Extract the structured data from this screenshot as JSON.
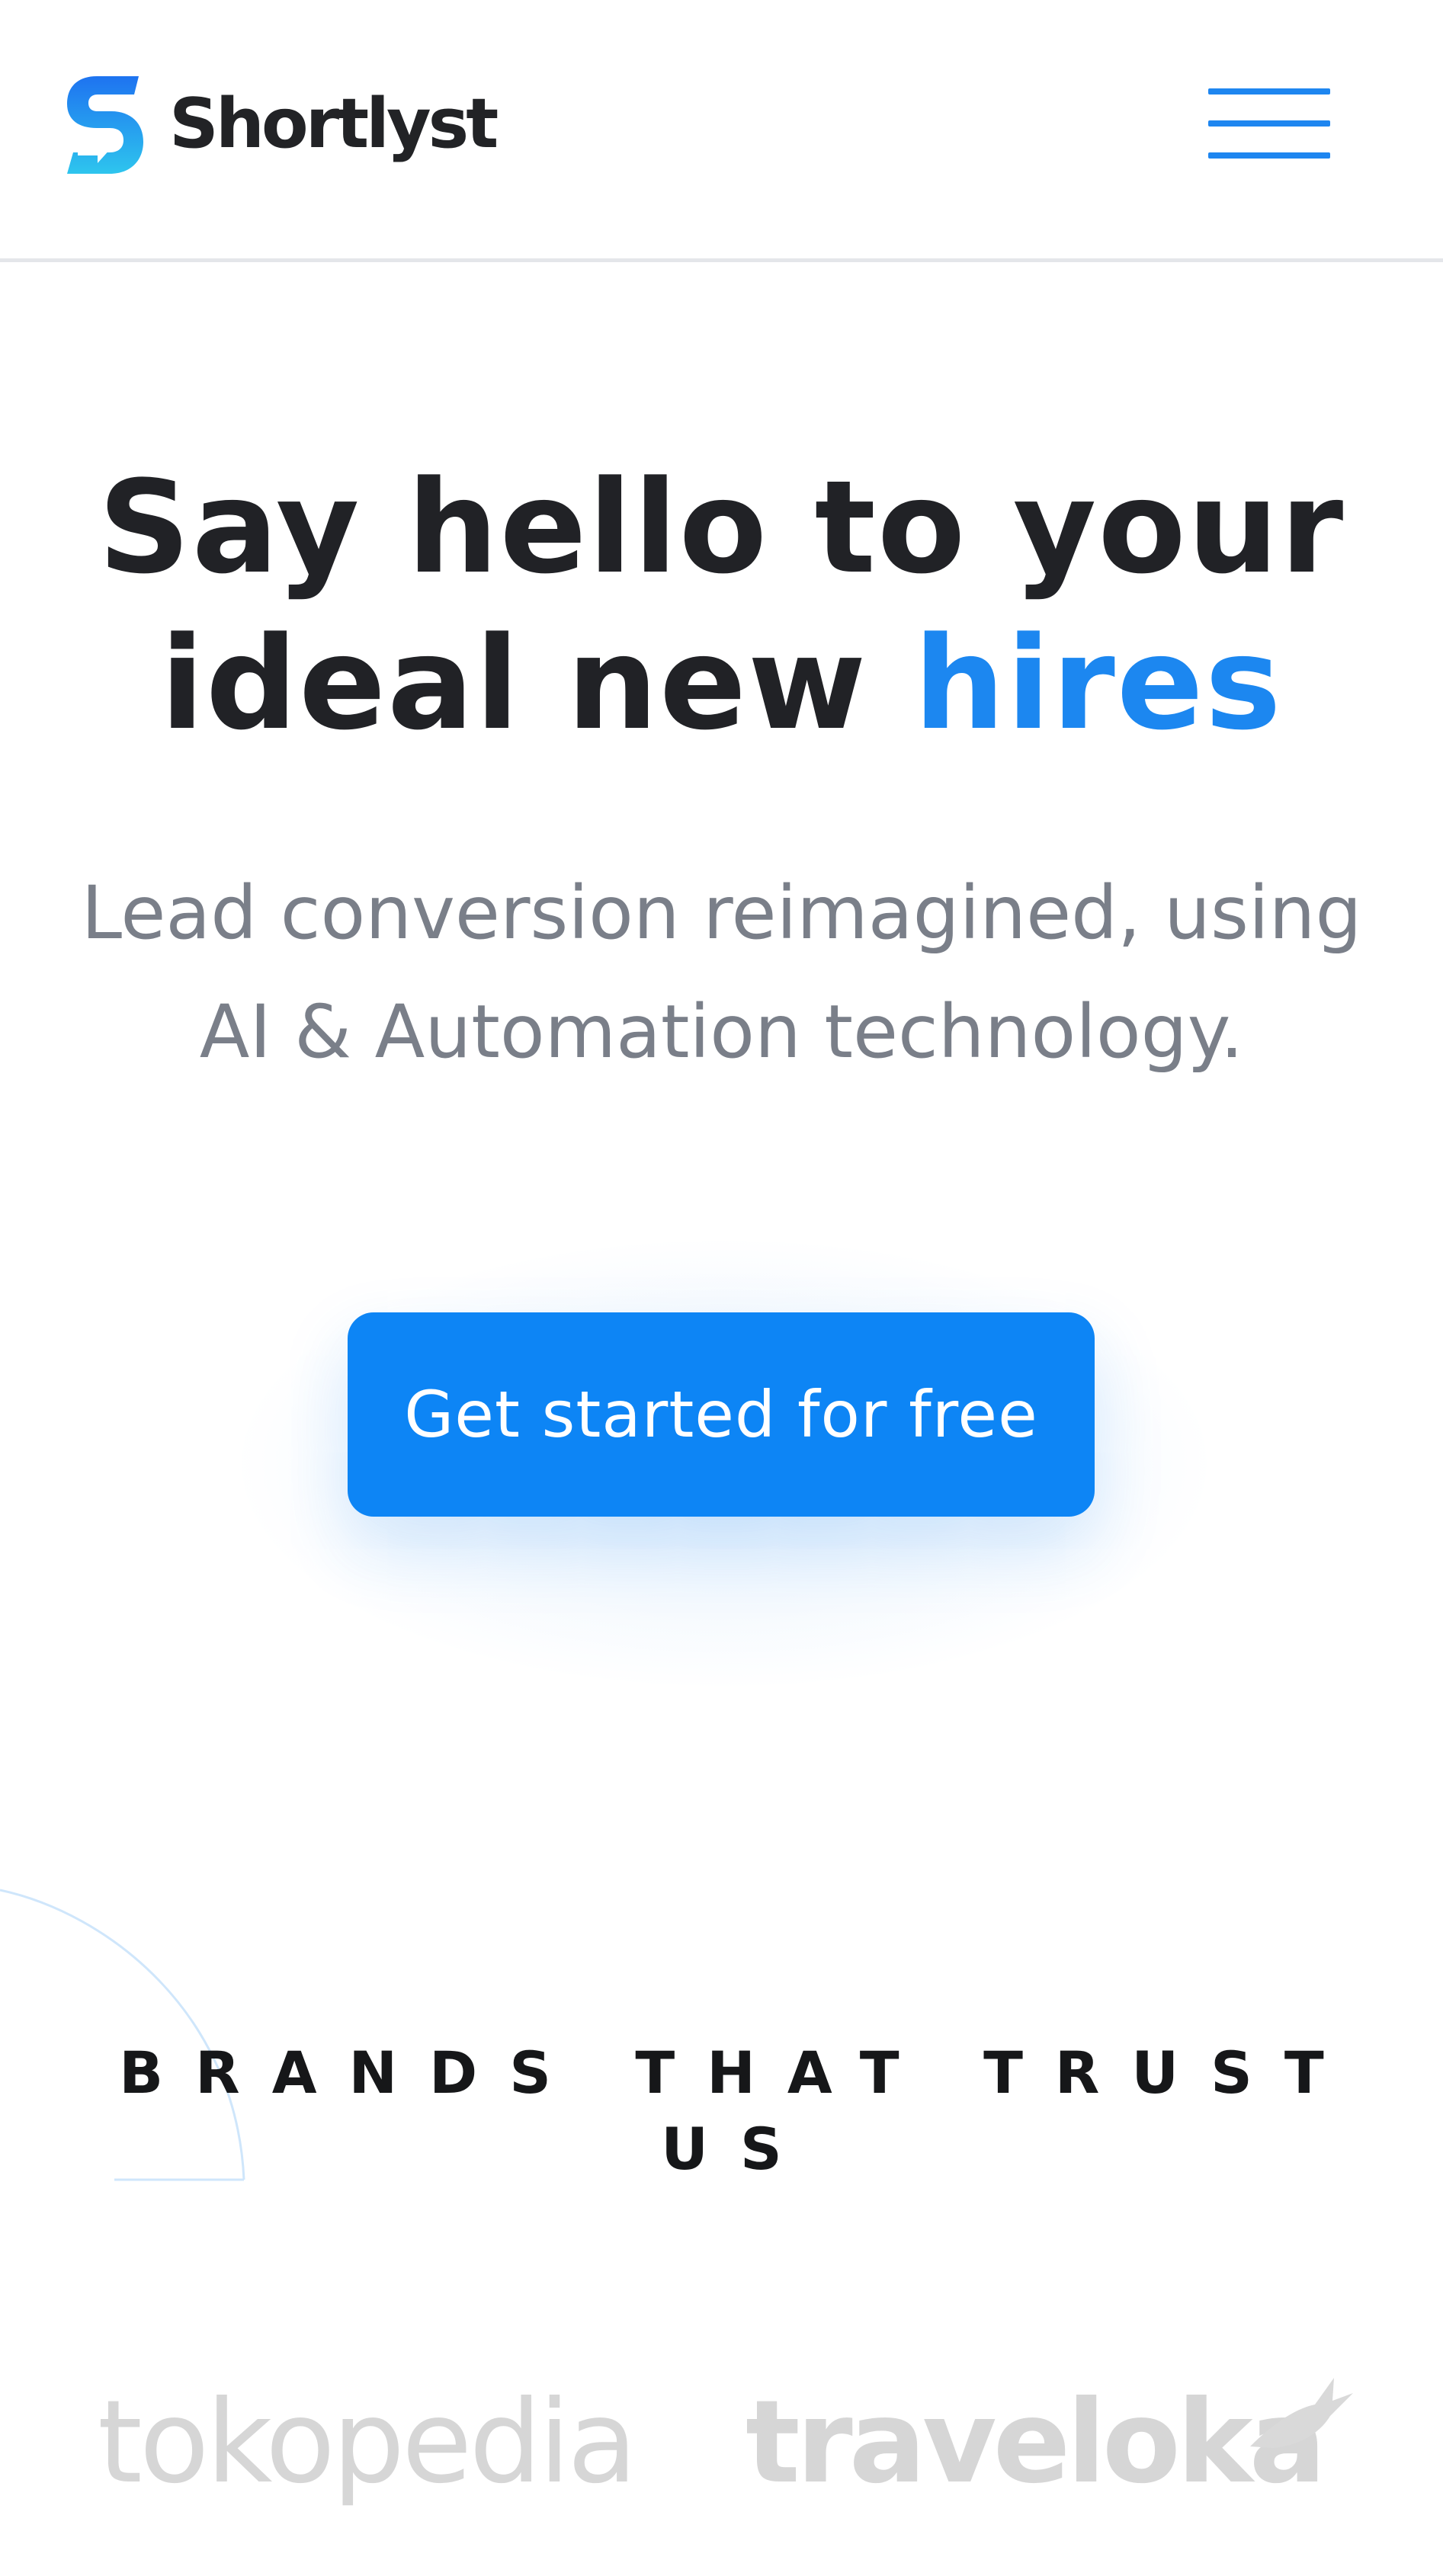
{
  "header": {
    "brand_name": "Shortlyst",
    "logo_icon": "shortlyst-s-logo-icon",
    "menu_icon": "hamburger-menu-icon"
  },
  "hero": {
    "title_part1": "Say hello to your",
    "title_part2": "ideal new",
    "title_accent": "hires",
    "subtitle_line1": "Lead conversion reimagined, using",
    "subtitle_line2": "AI & Automation technology.",
    "cta_label": "Get started for free"
  },
  "brands": {
    "heading": "BRANDS THAT TRUST US",
    "logos": [
      {
        "name": "tokopedia"
      },
      {
        "name": "traveloka"
      }
    ]
  },
  "colors": {
    "accent": "#1c87f0",
    "cta": "#0d85f5",
    "title": "#212226",
    "subtitle": "#7a7f89",
    "brand_logo_gray": "#d6d6d6"
  }
}
